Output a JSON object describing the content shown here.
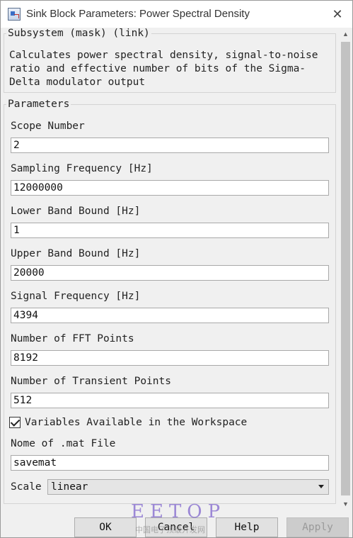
{
  "window": {
    "title": "Sink Block Parameters: Power Spectral Density",
    "close_glyph": "✕"
  },
  "mask": {
    "legend": "Subsystem (mask) (link)",
    "description": "Calculates power spectral density, signal-to-noise\nratio and effective number of bits of the Sigma-\nDelta modulator output"
  },
  "params": {
    "legend": "Parameters",
    "fields": [
      {
        "label": "Scope Number",
        "value": "2"
      },
      {
        "label": "Sampling Frequency [Hz]",
        "value": "12000000"
      },
      {
        "label": "Lower Band Bound [Hz]",
        "value": "1"
      },
      {
        "label": "Upper Band Bound [Hz]",
        "value": "20000"
      },
      {
        "label": "Signal Frequency [Hz]",
        "value": "4394"
      },
      {
        "label": "Number of FFT Points",
        "value": "8192"
      },
      {
        "label": "Number of Transient Points",
        "value": "512"
      }
    ],
    "checkbox": {
      "label": "Variables Available in the Workspace",
      "checked": true
    },
    "mat_file": {
      "label": "Nome of .mat File",
      "value": "savemat"
    },
    "scale": {
      "label": "Scale",
      "selected": "linear"
    }
  },
  "buttons": {
    "ok": "OK",
    "cancel": "Cancel",
    "help": "Help",
    "apply": "Apply"
  },
  "watermark": {
    "text": "EETOP",
    "subtext": "中国电子顶级开发网"
  },
  "icons": [
    "app-block-icon",
    "close-icon",
    "checkmark-icon",
    "chevron-down-icon",
    "scroll-up-icon",
    "scroll-down-icon"
  ]
}
